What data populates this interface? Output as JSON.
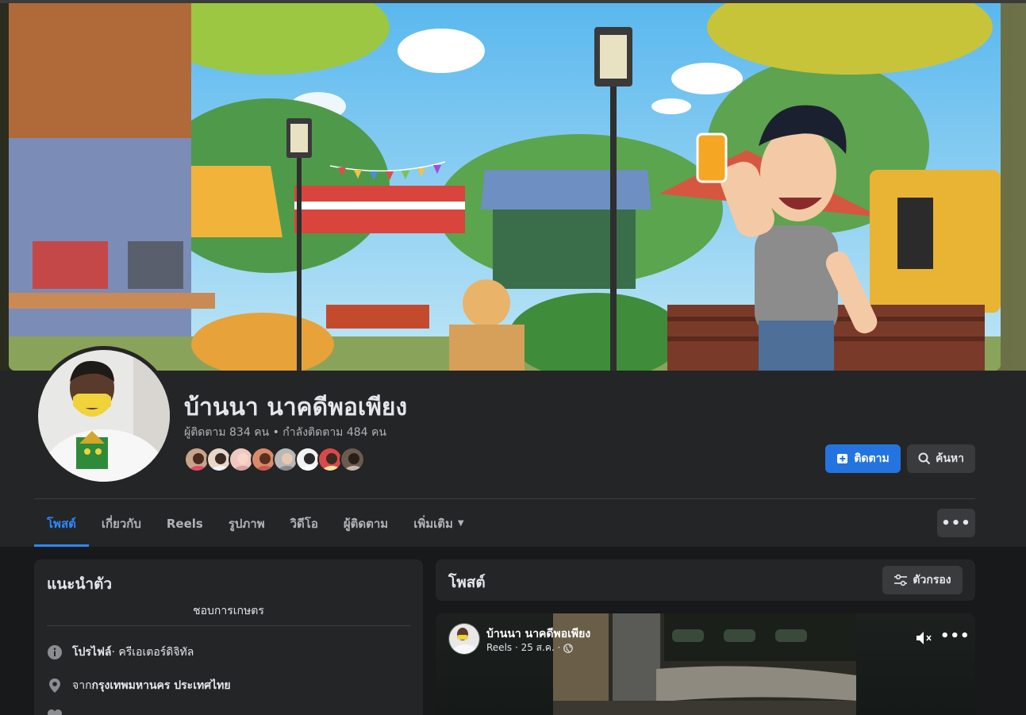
{
  "profile": {
    "name": "บ้านนา นาคดีพอเพียง",
    "stats": "ผู้ติดตาม 834 คน • กำลังติดตาม 484 คน"
  },
  "actions": {
    "follow_label": "ติดตาม",
    "search_label": "ค้นหา",
    "more_label": "•••"
  },
  "tabs": [
    {
      "label": "โพสต์",
      "active": true
    },
    {
      "label": "เกี่ยวกับ"
    },
    {
      "label": "Reels"
    },
    {
      "label": "รูปภาพ"
    },
    {
      "label": "วิดีโอ"
    },
    {
      "label": "ผู้ติดตาม"
    },
    {
      "label": "เพิ่มเติม"
    }
  ],
  "intro": {
    "title": "แนะนำตัว",
    "bio": "ชอบการเกษตร",
    "profile_prefix": "โปรไฟล์",
    "profile_value": " · ครีเอเตอร์ดิจิทัล",
    "from_prefix": "จาก ",
    "from_value": "กรุงเทพมหานคร ประเทศไทย"
  },
  "posts": {
    "title": "โพสต์",
    "filter_label": "ตัวกรอง"
  },
  "reel": {
    "author": "บ้านนา นาคดีพอเพียง",
    "meta": "Reels · 25 ส.ค. ·",
    "more_label": "•••"
  },
  "colors": {
    "accent": "#2374e1",
    "tab_active": "#2d88ff",
    "background": "#18191a",
    "card": "#242526"
  },
  "icons": [
    "follow-plus-icon",
    "search-icon",
    "info-icon",
    "location-pin-icon",
    "filter-icon",
    "mute-icon",
    "globe-icon"
  ]
}
